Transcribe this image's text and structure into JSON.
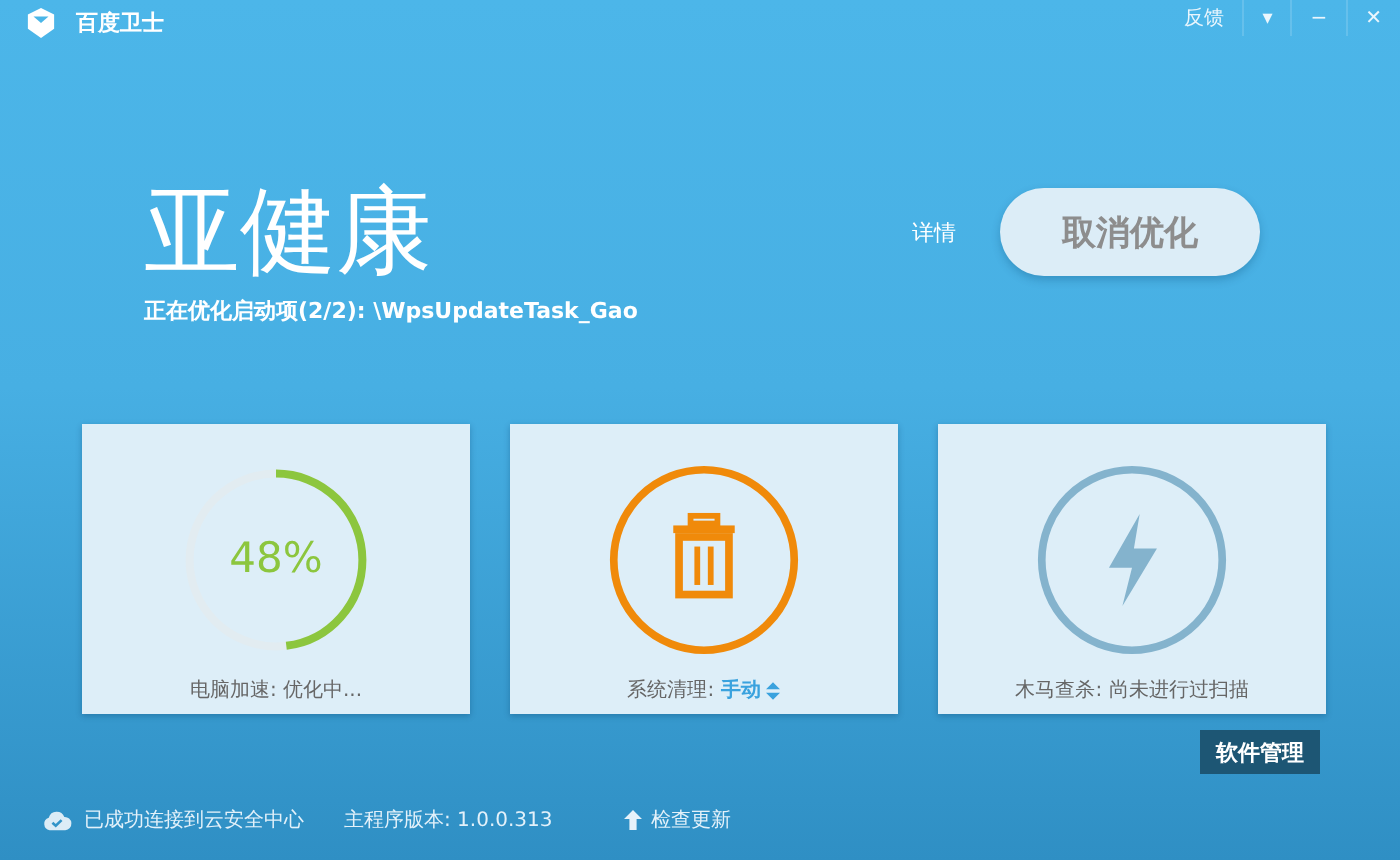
{
  "window": {
    "title": "百度卫士",
    "controls": [
      "反馈",
      "▾",
      "−",
      "✕"
    ]
  },
  "status": {
    "headline": "亚健康",
    "progress_text": "正在优化启动项(2/2): \\WpsUpdateTask_Gao",
    "details_link": "详情",
    "action_button": "取消优化"
  },
  "cards": [
    {
      "kind": "gauge",
      "level": 0.48,
      "reading": "48%",
      "label": "电脑加速: 优化中..."
    },
    {
      "kind": "trash",
      "label": "系统清理: ",
      "mode": "手动"
    },
    {
      "kind": "bolt",
      "label": "木马查杀: 尚未进行过扫描"
    }
  ],
  "side_button": "软件管理",
  "footer": {
    "connection": "已成功连接到云安全中心",
    "version": "主程序版本: 1.0.0.313",
    "update_link": "检查更新"
  }
}
